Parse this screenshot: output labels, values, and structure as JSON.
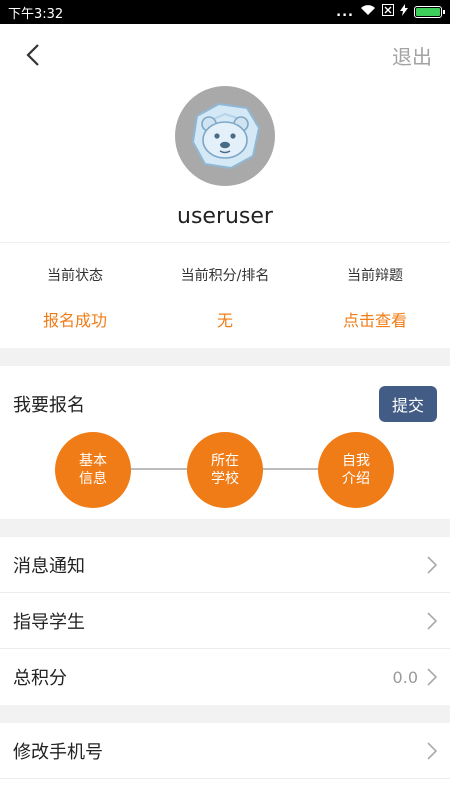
{
  "status_bar": {
    "time": "下午3:32",
    "dots": "...",
    "battery_level": 1.0,
    "icons": [
      "wifi-icon",
      "sim-x-icon",
      "charging-icon",
      "battery-icon"
    ]
  },
  "header": {
    "back_icon": "chevron-left-icon",
    "logout_label": "退出"
  },
  "profile": {
    "avatar_icon": "polar-bear-avatar",
    "username": "useruser"
  },
  "stats": [
    {
      "label": "当前状态",
      "value": "报名成功"
    },
    {
      "label": "当前积分/排名",
      "value": "无"
    },
    {
      "label": "当前辩题",
      "value": "点击查看"
    }
  ],
  "signup": {
    "title": "我要报名",
    "submit_label": "提交",
    "steps": [
      {
        "line1": "基本",
        "line2": "信息"
      },
      {
        "line1": "所在",
        "line2": "学校"
      },
      {
        "line1": "自我",
        "line2": "介绍"
      }
    ]
  },
  "menu_group1": [
    {
      "label": "消息通知",
      "value": ""
    },
    {
      "label": "指导学生",
      "value": ""
    },
    {
      "label": "总积分",
      "value": "0.0"
    }
  ],
  "menu_group2": [
    {
      "label": "修改手机号",
      "value": ""
    }
  ],
  "colors": {
    "accent": "#f07c18",
    "button": "#425c85",
    "divider": "#f2f2f2"
  }
}
